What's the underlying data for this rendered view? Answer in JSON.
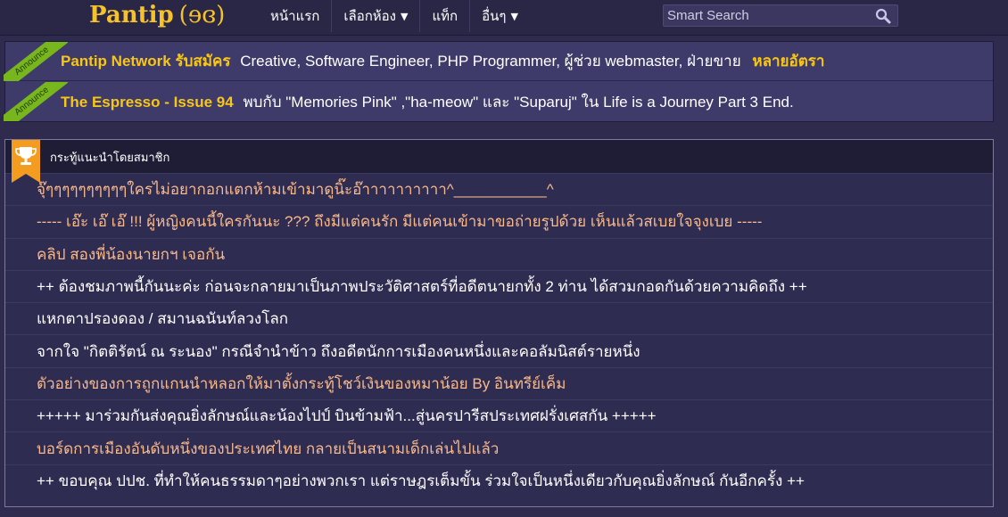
{
  "header": {
    "logo_text": "Pantip",
    "logo_mark": "(ɘɞ)",
    "nav": [
      {
        "label": "หน้าแรก",
        "has_caret": false
      },
      {
        "label": "เลือกห้อง",
        "has_caret": true
      },
      {
        "label": "แท็ก",
        "has_caret": false
      },
      {
        "label": "อื่นๆ",
        "has_caret": true
      }
    ],
    "caret": "▼",
    "search": {
      "placeholder": "Smart Search",
      "icon": "search-icon"
    }
  },
  "announcements": {
    "badge_label": "Announce",
    "badge_color": "#78b61e",
    "items": [
      {
        "title": "Pantip Network รับสมัคร",
        "body": "Creative, Software Engineer, PHP Programmer, ผู้ช่วย webmaster, ฝ่ายขาย",
        "tail": "หลายอัตรา"
      },
      {
        "title": "The Espresso - Issue 94",
        "body": "พบกับ \"Memories Pink\" ,\"ha-meow\" และ \"Suparuj\" ใน Life is a Journey Part 3 End.",
        "tail": ""
      }
    ]
  },
  "recommended": {
    "title": "กระทู้แนะนำโดยสมาชิก",
    "icon": "trophy-icon",
    "items": [
      {
        "text": "จุ๊ๆๆๆๆๆๆๆๆๆๆใครไม่อยากอกแตกห้ามเข้ามาดูนิ๊ะอ๊าาาาาาาาาา^___________^",
        "color": "orange"
      },
      {
        "text": "----- เอ๊ะ เอ๊ เอ๊ !!! ผู้หญิงคนนี้ใครกันนะ ??? ถึงมีแต่คนรัก มีแต่คนเข้ามาขอถ่ายรูปด้วย เห็นแล้วสเบยใจจุงเบย -----",
        "color": "orange"
      },
      {
        "text": "คลิป สองพี่น้องนายกฯ เจอกัน",
        "color": "orange"
      },
      {
        "text": "++ ต้องชมภาพนี้กันนะค่ะ ก่อนจะกลายมาเป็นภาพประวัติศาสตร์ที่อดีตนายกทั้ง 2 ท่าน ได้สวมกอดกันด้วยความคิดถึง ++",
        "color": "white"
      },
      {
        "text": "แหกตาปรองดอง / สมานฉนันท์ลวงโลก",
        "color": "white"
      },
      {
        "text": "จากใจ \"กิตติรัตน์ ณ ระนอง\" กรณีจำนำข้าว ถึงอดีตนักการเมืองคนหนึ่งและคอลัมนิสต์รายหนึ่ง",
        "color": "white"
      },
      {
        "text": "ตัวอย่างของการถูกแกนนำหลอกให้มาตั้งกระทู้โชว์เงินของหมาน้อย By อินทรีย์เค็ม",
        "color": "orange"
      },
      {
        "text": "+++++ มาร่วมกันส่งคุณยิ่งลักษณ์และน้องไปป์ บินข้ามฟ้า...สู่นครปารีสประเทศฝรั่งเศสกัน +++++",
        "color": "white"
      },
      {
        "text": "บอร์ดการเมืองอันดับหนึ่งของประเทศไทย กลายเป็นสนามเด็กเล่นไปแล้ว",
        "color": "orange"
      },
      {
        "text": "++ ขอบคุณ ปปช. ที่ทำให้คนธรรมดาๆอย่างพวกเรา แต่ราษฎรเต็มขั้น ร่วมใจเป็นหนึ่งเดียวกับคุณยิ่งลักษณ์ กันอีกครั้ง ++",
        "color": "white"
      }
    ]
  },
  "colors": {
    "background": "#2e2b4e",
    "accent_yellow": "#f7c617",
    "link_orange": "#f9b98a",
    "trophy_orange": "#f39c1f"
  }
}
